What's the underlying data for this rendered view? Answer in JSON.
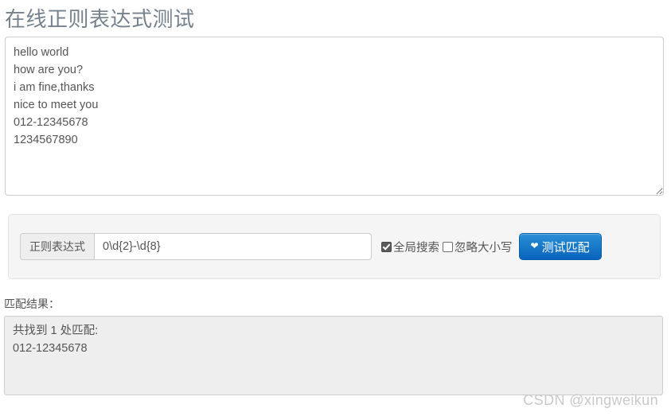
{
  "page": {
    "title": "在线正则表达式测试"
  },
  "source": {
    "name": "source-text",
    "value": "hello world\nhow are you?\ni am fine,thanks\nnice to meet you\n012-12345678\n1234567890",
    "placeholder": ""
  },
  "form": {
    "regex_label": "正则表达式",
    "regex_value": "0\\d{2}-\\d{8}",
    "regex_placeholder": "",
    "options": [
      {
        "label": "全局搜索",
        "checked": true
      },
      {
        "label": "忽略大小写",
        "checked": false
      }
    ],
    "test_button": {
      "label": "测试匹配",
      "icon": "chevron-down-icon",
      "icon_glyph": "❤",
      "accent_color": "#1a7cc9"
    }
  },
  "result": {
    "label": "匹配结果：",
    "summary": "共找到 1 处匹配:",
    "matches": [
      "012-12345678"
    ],
    "text": "共找到 1 处匹配:\n012-12345678"
  },
  "watermark": {
    "text": "CSDN @xingweikun"
  },
  "colors": {
    "title": "#75818d",
    "text": "#555555",
    "panel_bg": "#f5f5f5",
    "result_bg": "#eeeeee",
    "button_accent": "#1a7cc9",
    "watermark": "#c9c9c9"
  }
}
